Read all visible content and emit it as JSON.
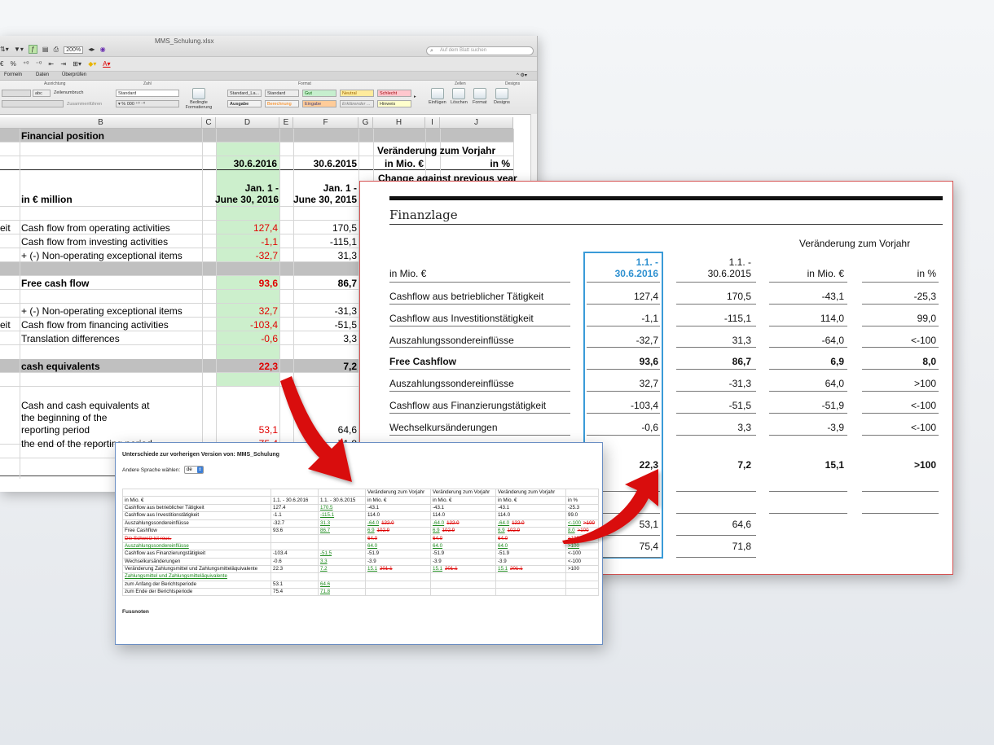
{
  "excel": {
    "filename": "MMS_Schulung.xlsx",
    "zoom": "200%",
    "search_placeholder": "Auf dem Blatt suchen",
    "toolbar_symbols": [
      "€",
      "%"
    ],
    "ribbon_tabs": [
      "Formeln",
      "Daten",
      "Überprüfen"
    ],
    "ribbon_groups": [
      "Ausrichtung",
      "Zahl",
      "Format",
      "Zellen",
      "Designs"
    ],
    "ribbon_labels": {
      "wrap": "Zeilenumbruch",
      "merge": "Zusammenführen",
      "number_format": "Standard",
      "cond_format": "Bedingte Formatierung",
      "insert": "Einfügen",
      "delete": "Löschen",
      "format": "Format",
      "designs": "Designs",
      "abc": "abc"
    },
    "cell_styles": [
      {
        "label": "Standard_La...",
        "bg": "#ffffff"
      },
      {
        "label": "Standard",
        "bg": "#ffffff"
      },
      {
        "label": "Gut",
        "bg": "#c6efce"
      },
      {
        "label": "Neutral",
        "bg": "#ffeb9c"
      },
      {
        "label": "Schlecht",
        "bg": "#ffc7ce"
      },
      {
        "label": "Ausgabe",
        "bg": "#f2f2f2"
      },
      {
        "label": "Berechnung",
        "bg": "#f2f2f2"
      },
      {
        "label": "Eingabe",
        "bg": "#ffcc99"
      },
      {
        "label": "Erklärender ...",
        "bg": "#ffffff"
      },
      {
        "label": "Hinweis",
        "bg": "#ffffcc"
      }
    ],
    "columns": [
      "B",
      "C",
      "D",
      "E",
      "F",
      "G",
      "H",
      "I",
      "J"
    ],
    "header": {
      "title": "Financial position",
      "date_d": "30.6.2016",
      "date_f": "30.6.2015",
      "change_label": "Veränderung zum Vorjahr",
      "in_mio": "in Mio. €",
      "in_pct": "in %",
      "change_en": "Change against previous year",
      "unit": "in € million",
      "period_d_1": "Jan. 1 -",
      "period_d_2": "June 30, 2016",
      "period_f_1": "Jan. 1 -",
      "period_f_2": "June 30, 2015"
    },
    "rows": [
      {
        "a": "eit",
        "b": "Cash flow from operating activities",
        "d": "127,4",
        "f": "170,5"
      },
      {
        "a": "",
        "b": "Cash flow from investing activities",
        "d": "-1,1",
        "f": "-115,1"
      },
      {
        "a": "",
        "b": "+ (-) Non-operating exceptional items",
        "d": "-32,7",
        "f": "31,3"
      },
      {
        "a": "",
        "b": "Free cash flow",
        "d": "93,6",
        "f": "86,7"
      },
      {
        "a": "",
        "b": "+ (-) Non-operating exceptional items",
        "d": "32,7",
        "f": "-31,3"
      },
      {
        "a": "eit",
        "b": "Cash flow from financing activities",
        "d": "-103,4",
        "f": "-51,5"
      },
      {
        "a": "",
        "b": "Translation differences",
        "d": "-0,6",
        "f": "3,3"
      },
      {
        "a": "",
        "b": "cash equivalents",
        "d": "22,3",
        "f": "7,2"
      },
      {
        "a": "",
        "b": "Cash and cash equivalents at",
        "d": "",
        "f": ""
      },
      {
        "a": "",
        "b": "the beginning of the",
        "d": "",
        "f": ""
      },
      {
        "a": "",
        "b": "reporting period",
        "d": "53,1",
        "f": "64,6"
      },
      {
        "a": "",
        "b": "the end of the reporting period",
        "d": "75,4",
        "f": "71,8"
      }
    ]
  },
  "finanzlage": {
    "title": "Finanzlage",
    "change_header": "Veränderung zum Vorjahr",
    "unit": "in Mio. €",
    "col1_l1": "1.1. -",
    "col1_l2": "30.6.2016",
    "col2_l1": "1.1. -",
    "col2_l2": "30.6.2015",
    "col3": "in Mio. €",
    "col4": "in %",
    "rows": [
      {
        "label": "Cashflow aus betrieblicher Tätigkeit",
        "v1": "127,4",
        "v2": "170,5",
        "v3": "-43,1",
        "v4": "-25,3",
        "bold": false
      },
      {
        "label": "Cashflow aus Investitionstätigkeit",
        "v1": "-1,1",
        "v2": "-115,1",
        "v3": "114,0",
        "v4": "99,0",
        "bold": false
      },
      {
        "label": "Auszahlungssondereinflüsse",
        "v1": "-32,7",
        "v2": "31,3",
        "v3": "-64,0",
        "v4": "<-100",
        "bold": false
      },
      {
        "label": "Free Cashflow",
        "v1": "93,6",
        "v2": "86,7",
        "v3": "6,9",
        "v4": "8,0",
        "bold": true
      },
      {
        "label": "Auszahlungssondereinflüsse",
        "v1": "32,7",
        "v2": "-31,3",
        "v3": "64,0",
        "v4": ">100",
        "bold": false
      },
      {
        "label": "Cashflow aus Finanzierungstätigkeit",
        "v1": "-103,4",
        "v2": "-51,5",
        "v3": "-51,9",
        "v4": "<-100",
        "bold": false
      },
      {
        "label": "Wechselkursänderungen",
        "v1": "-0,6",
        "v2": "3,3",
        "v3": "-3,9",
        "v4": "<-100",
        "bold": false
      },
      {
        "label": "",
        "v1": "22,3",
        "v2": "7,2",
        "v3": "15,1",
        "v4": ">100",
        "bold": true
      },
      {
        "label": "",
        "v1": "53,1",
        "v2": "64,6",
        "v3": "",
        "v4": "",
        "bold": false
      },
      {
        "label": "",
        "v1": "75,4",
        "v2": "71,8",
        "v3": "",
        "v4": "",
        "bold": false
      }
    ]
  },
  "diff": {
    "title": "Unterschiede zur vorherigen Version von: MMS_Schulung",
    "language_label": "Andere Sprache wählen:",
    "language_value": "de",
    "footnotes": "Fussnoten",
    "header1": [
      "",
      "",
      "",
      "Veränderung zum Vorjahr",
      "Veränderung zum Vorjahr",
      "Veränderung zum Vorjahr",
      ""
    ],
    "header2": [
      "in Mio. €",
      "1.1. - 30.6.2016",
      "1.1. - 30.6.2015",
      "in Mio. €",
      "in Mio. €",
      "in Mio. €",
      "in %"
    ],
    "rows": [
      [
        {
          "t": "Cashflow aus betrieblicher Tätigkeit"
        },
        {
          "t": "127.4"
        },
        {
          "t": "170.5",
          "c": "ins"
        },
        {
          "t": "-43.1"
        },
        {
          "t": "-43.1"
        },
        {
          "t": "-43.1"
        },
        {
          "t": "-25.3"
        }
      ],
      [
        {
          "t": "Cashflow aus Investitionstätigkeit"
        },
        {
          "t": "-1.1"
        },
        {
          "t": "-115.1",
          "c": "ins"
        },
        {
          "t": "114.0"
        },
        {
          "t": "114.0"
        },
        {
          "t": "114.0"
        },
        {
          "t": "99.0"
        }
      ],
      [
        {
          "t": "Auszahlungssondereinflüsse"
        },
        {
          "t": "-32.7"
        },
        {
          "t": "31.3",
          "c": "ins"
        },
        {
          "t": "-64.0",
          "c": "ins",
          "d": "122.0"
        },
        {
          "t": "-64.0",
          "c": "ins",
          "d": "122.0"
        },
        {
          "t": "-64.0",
          "c": "ins",
          "d": "122.0"
        },
        {
          "t": "<-100",
          "c": "ins",
          "d": ">100"
        }
      ],
      [
        {
          "t": "Free Cashflow"
        },
        {
          "t": "93.6"
        },
        {
          "t": "86.7",
          "c": "ins"
        },
        {
          "t": "6.9",
          "c": "ins",
          "d": "102.9"
        },
        {
          "t": "6.9",
          "c": "ins",
          "d": "102.9"
        },
        {
          "t": "6.9",
          "c": "ins",
          "d": "102.9"
        },
        {
          "t": "8.0",
          "c": "ins",
          "d": ">100"
        }
      ],
      [
        {
          "t": "Die Schweiz ist rous.",
          "c": "del"
        },
        {
          "t": ""
        },
        {
          "t": ""
        },
        {
          "t": "64.0",
          "c": "del"
        },
        {
          "t": "64.0",
          "c": "del"
        },
        {
          "t": "64.0",
          "c": "del"
        },
        {
          "t": ">100",
          "c": "del"
        }
      ],
      [
        {
          "t": "Auszahlungssondereinflüsse",
          "c": "ins"
        },
        {
          "t": ""
        },
        {
          "t": ""
        },
        {
          "t": "64.0",
          "c": "ins"
        },
        {
          "t": "64.0",
          "c": "ins"
        },
        {
          "t": "64.0",
          "c": "ins"
        },
        {
          "t": ">100",
          "c": "ins"
        }
      ],
      [
        {
          "t": "Cashflow aus Finanzierungstätigkeit"
        },
        {
          "t": "-103.4"
        },
        {
          "t": "-51.5",
          "c": "ins"
        },
        {
          "t": "-51.9"
        },
        {
          "t": "-51.9"
        },
        {
          "t": "-51.9"
        },
        {
          "t": "<-100"
        }
      ],
      [
        {
          "t": "Wechselkursänderungen"
        },
        {
          "t": "-0.6"
        },
        {
          "t": "3.3",
          "c": "ins"
        },
        {
          "t": "-3.9"
        },
        {
          "t": "-3.9"
        },
        {
          "t": "-3.9"
        },
        {
          "t": "<-100"
        }
      ],
      [
        {
          "t": "Veränderung Zahlungsmittel und Zahlungsmitteläquivalente"
        },
        {
          "t": "22.3"
        },
        {
          "t": "7.2",
          "c": "ins"
        },
        {
          "t": "15.1",
          "c": "ins",
          "d": "201.1"
        },
        {
          "t": "15.1",
          "c": "ins",
          "d": "201.1"
        },
        {
          "t": "15.1",
          "c": "ins",
          "d": "201.1"
        },
        {
          "t": ">100"
        }
      ],
      [
        {
          "t": "Zahlungsmittel und Zahlungsmitteläquivalente",
          "c": "ins"
        },
        {
          "t": ""
        },
        {
          "t": ""
        },
        {
          "t": ""
        },
        {
          "t": ""
        },
        {
          "t": ""
        },
        {
          "t": ""
        }
      ],
      [
        {
          "t": "zum Anfang der Berichtsperiode"
        },
        {
          "t": "53.1"
        },
        {
          "t": "64.6",
          "c": "ins"
        },
        {
          "t": ""
        },
        {
          "t": ""
        },
        {
          "t": ""
        },
        {
          "t": ""
        }
      ],
      [
        {
          "t": "zum Ende der Berichtsperiode"
        },
        {
          "t": "75.4"
        },
        {
          "t": "71.8",
          "c": "ins"
        },
        {
          "t": ""
        },
        {
          "t": ""
        },
        {
          "t": ""
        },
        {
          "t": ""
        }
      ]
    ]
  },
  "colors": {
    "excel_red": "#e00000",
    "highlight_green": "#ccefcc",
    "accent_blue": "#3a9bd8",
    "arrow_red": "#d90f0f",
    "diff_insert": "#1d8a1d",
    "diff_delete": "#dd0000"
  }
}
